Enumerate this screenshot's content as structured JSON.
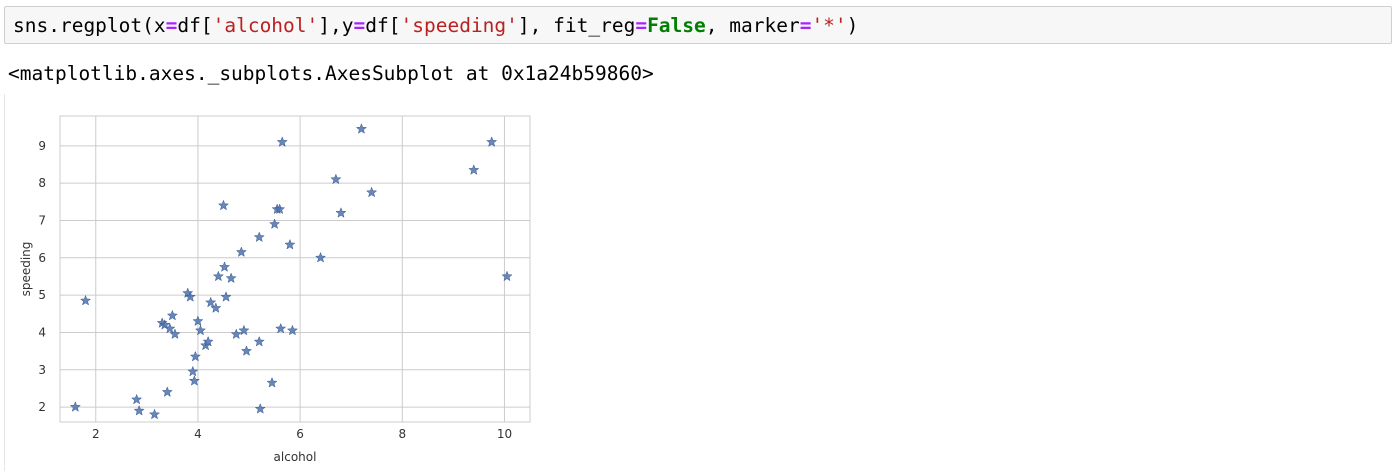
{
  "code_cell": {
    "tokens": [
      {
        "text": "sns.regplot(x",
        "cls": ""
      },
      {
        "text": "=",
        "cls": "k-eq"
      },
      {
        "text": "df[",
        "cls": ""
      },
      {
        "text": "'alcohol'",
        "cls": "k-str"
      },
      {
        "text": "],y",
        "cls": ""
      },
      {
        "text": "=",
        "cls": "k-eq"
      },
      {
        "text": "df[",
        "cls": ""
      },
      {
        "text": "'speeding'",
        "cls": "k-str"
      },
      {
        "text": "], fit_reg",
        "cls": ""
      },
      {
        "text": "=",
        "cls": "k-eq"
      },
      {
        "text": "False",
        "cls": "k-kw"
      },
      {
        "text": ", marker",
        "cls": ""
      },
      {
        "text": "=",
        "cls": "k-eq"
      },
      {
        "text": "'*'",
        "cls": "k-str"
      },
      {
        "text": ")",
        "cls": ""
      }
    ]
  },
  "output": {
    "repr_text": "<matplotlib.axes._subplots.AxesSubplot at 0x1a24b59860>"
  },
  "chart_data": {
    "type": "scatter",
    "xlabel": "alcohol",
    "ylabel": "speeding",
    "xlim": [
      1.3,
      10.5
    ],
    "ylim": [
      1.6,
      9.8
    ],
    "xticks": [
      2,
      4,
      6,
      8,
      10
    ],
    "yticks": [
      2,
      3,
      4,
      5,
      6,
      7,
      8,
      9
    ],
    "grid": true,
    "marker": "*",
    "marker_color": "#4c72b0",
    "points": [
      {
        "x": 1.6,
        "y": 2.0
      },
      {
        "x": 1.8,
        "y": 4.85
      },
      {
        "x": 2.8,
        "y": 2.2
      },
      {
        "x": 2.85,
        "y": 1.9
      },
      {
        "x": 3.15,
        "y": 1.8
      },
      {
        "x": 3.3,
        "y": 4.25
      },
      {
        "x": 3.35,
        "y": 4.2
      },
      {
        "x": 3.4,
        "y": 2.4
      },
      {
        "x": 3.45,
        "y": 4.1
      },
      {
        "x": 3.5,
        "y": 4.45
      },
      {
        "x": 3.55,
        "y": 3.95
      },
      {
        "x": 3.8,
        "y": 5.05
      },
      {
        "x": 3.85,
        "y": 4.95
      },
      {
        "x": 3.9,
        "y": 2.95
      },
      {
        "x": 3.93,
        "y": 2.7
      },
      {
        "x": 3.95,
        "y": 3.35
      },
      {
        "x": 4.0,
        "y": 4.3
      },
      {
        "x": 4.05,
        "y": 4.05
      },
      {
        "x": 4.15,
        "y": 3.65
      },
      {
        "x": 4.2,
        "y": 3.75
      },
      {
        "x": 4.25,
        "y": 4.8
      },
      {
        "x": 4.35,
        "y": 4.65
      },
      {
        "x": 4.4,
        "y": 5.5
      },
      {
        "x": 4.5,
        "y": 7.4
      },
      {
        "x": 4.52,
        "y": 5.75
      },
      {
        "x": 4.55,
        "y": 4.95
      },
      {
        "x": 4.65,
        "y": 5.45
      },
      {
        "x": 4.75,
        "y": 3.95
      },
      {
        "x": 4.85,
        "y": 6.15
      },
      {
        "x": 4.9,
        "y": 4.05
      },
      {
        "x": 4.95,
        "y": 3.5
      },
      {
        "x": 5.2,
        "y": 3.75
      },
      {
        "x": 5.22,
        "y": 1.95
      },
      {
        "x": 5.2,
        "y": 6.55
      },
      {
        "x": 5.45,
        "y": 2.65
      },
      {
        "x": 5.5,
        "y": 6.9
      },
      {
        "x": 5.55,
        "y": 7.3
      },
      {
        "x": 5.6,
        "y": 7.3
      },
      {
        "x": 5.62,
        "y": 4.1
      },
      {
        "x": 5.65,
        "y": 9.1
      },
      {
        "x": 5.8,
        "y": 6.35
      },
      {
        "x": 5.85,
        "y": 4.05
      },
      {
        "x": 6.4,
        "y": 6.0
      },
      {
        "x": 6.7,
        "y": 8.1
      },
      {
        "x": 6.8,
        "y": 7.2
      },
      {
        "x": 7.2,
        "y": 9.45
      },
      {
        "x": 7.4,
        "y": 7.75
      },
      {
        "x": 9.4,
        "y": 8.35
      },
      {
        "x": 9.75,
        "y": 9.1
      },
      {
        "x": 10.05,
        "y": 5.5
      }
    ]
  }
}
